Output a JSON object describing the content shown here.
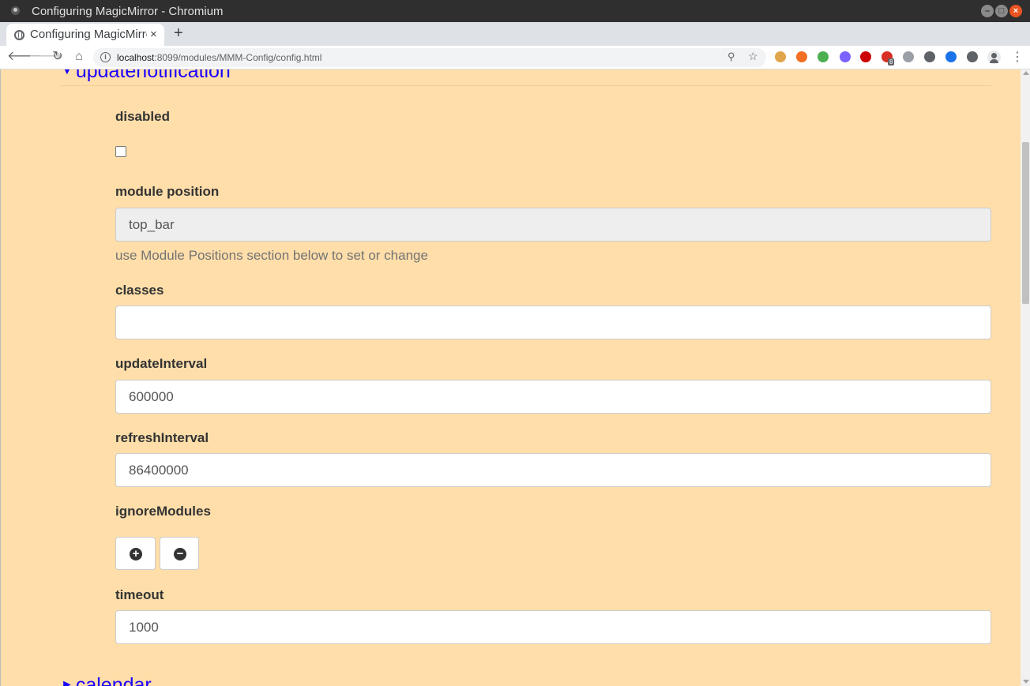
{
  "window": {
    "title": "Configuring MagicMirror - Chromium"
  },
  "tab": {
    "title": "Configuring MagicMirror",
    "close": "×",
    "new_tab": "+"
  },
  "address": {
    "host": "localhost",
    "path": ":8099/modules/MMM-Config/config.html"
  },
  "extensions": [
    {
      "name": "cookie-extension-icon",
      "color": "#e0a44a"
    },
    {
      "name": "orange-extension-icon",
      "color": "#f36f21"
    },
    {
      "name": "chrome-extension-icon",
      "color": "#4caf50"
    },
    {
      "name": "purple-extension-icon",
      "color": "#7b61ff"
    },
    {
      "name": "youtube-extension-icon",
      "color": "#cc0000"
    },
    {
      "name": "red-extension-icon",
      "color": "#d93025"
    },
    {
      "name": "dropbox-extension-icon",
      "color": "#9aa0a6"
    },
    {
      "name": "moon-extension-icon",
      "color": "#5f6368"
    },
    {
      "name": "screenshot-extension-icon",
      "color": "#1a73e8"
    },
    {
      "name": "puzzle-extension-icon",
      "color": "#5f6368"
    }
  ],
  "extension_badge": "8",
  "page": {
    "section_title": "updatenotification",
    "next_section_title": "calendar",
    "fields": {
      "disabled": {
        "label": "disabled",
        "checked": false
      },
      "position": {
        "label": "module position",
        "value": "top_bar",
        "help": "use Module Positions section below to set or change"
      },
      "classes": {
        "label": "classes",
        "value": ""
      },
      "updateInterval": {
        "label": "updateInterval",
        "value": "600000"
      },
      "refreshInterval": {
        "label": "refreshInterval",
        "value": "86400000"
      },
      "ignoreModules": {
        "label": "ignoreModules"
      },
      "timeout": {
        "label": "timeout",
        "value": "1000"
      }
    }
  },
  "colors": {
    "page_background": "#ffdeaa",
    "section_link": "#1a00ff"
  }
}
